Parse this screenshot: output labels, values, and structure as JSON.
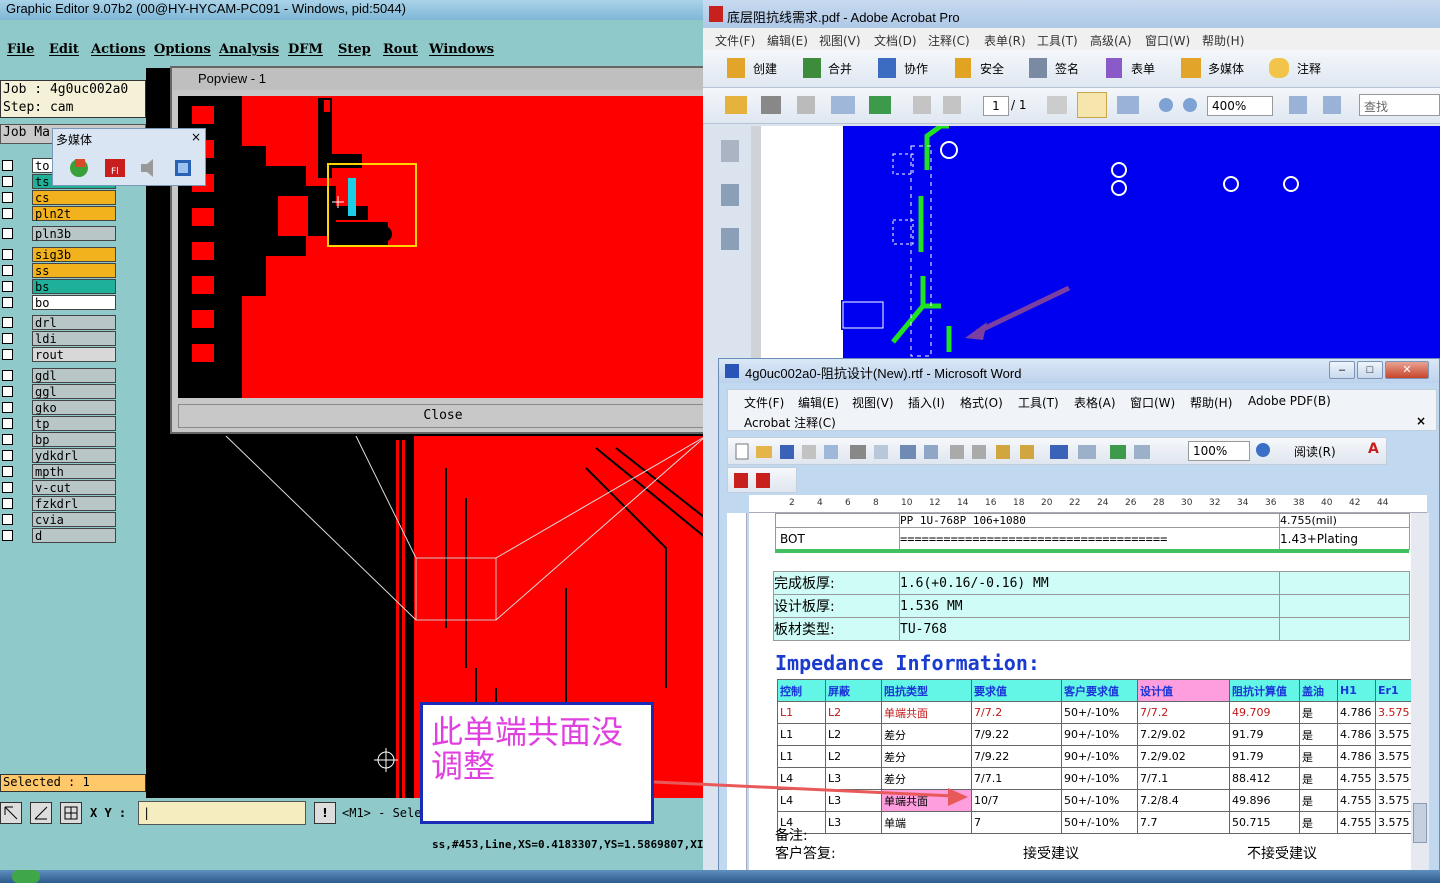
{
  "ge": {
    "title": "Graphic Editor 9.07b2 (00@HY-HYCAM-PC091 - Windows, pid:5044)",
    "menus": [
      "File",
      "Edit",
      "Actions",
      "Options",
      "Analysis",
      "DFM",
      "Step",
      "Rout",
      "Windows"
    ],
    "job_line": "Job : 4g0uc002a0",
    "step_line": "Step: cam",
    "job_tab": "Job Ma",
    "layers": [
      {
        "name": "to",
        "color": "#ffffff"
      },
      {
        "name": "ts",
        "color": "#1fb09a"
      },
      {
        "name": "cs",
        "color": "#f2b21e"
      },
      {
        "name": "pln2t",
        "color": "#f2b21e"
      },
      {
        "name": "pln3b",
        "color": "#b9c6c8"
      },
      {
        "name": "sig3b",
        "color": "#f2b21e"
      },
      {
        "name": "ss",
        "color": "#f2b21e"
      },
      {
        "name": "bs",
        "color": "#1fb09a"
      },
      {
        "name": "bo",
        "color": "#ffffff"
      },
      {
        "name": "drl",
        "color": "#b9c6c8"
      },
      {
        "name": "ldi",
        "color": "#b9c6c8"
      },
      {
        "name": "rout",
        "color": "#d8d8d8"
      },
      {
        "name": "gdl",
        "color": "#b9c6c8"
      },
      {
        "name": "ggl",
        "color": "#b9c6c8"
      },
      {
        "name": "gko",
        "color": "#b9c6c8"
      },
      {
        "name": "tp",
        "color": "#b9c6c8"
      },
      {
        "name": "bp",
        "color": "#b9c6c8"
      },
      {
        "name": "ydkdrl",
        "color": "#b9c6c8"
      },
      {
        "name": "mpth",
        "color": "#b9c6c8"
      },
      {
        "name": "v-cut",
        "color": "#b9c6c8"
      },
      {
        "name": "fzkdrl",
        "color": "#b9c6c8"
      },
      {
        "name": "cvia",
        "color": "#b9c6c8"
      },
      {
        "name": "d",
        "color": "#b9c6c8"
      }
    ],
    "selected": "Selected : 1",
    "xy_label": "X Y :",
    "xy_value": "|",
    "mode_text": "<M1> - Sele",
    "status_text": "ss,#453,Line,XS=0.4183307,YS=1.5869807,XI"
  },
  "popview": {
    "title": "Popview - 1",
    "close_label": "Close"
  },
  "multimedia": {
    "title": "多媒体",
    "close": "×"
  },
  "callout": {
    "text_line1": "此单端共面没",
    "text_line2": "调整"
  },
  "acrobat": {
    "title": "底层阻抗线需求.pdf - Adobe Acrobat Pro",
    "menus": [
      "文件(F)",
      "编辑(E)",
      "视图(V)",
      "文档(D)",
      "注释(C)",
      "表单(R)",
      "工具(T)",
      "高级(A)",
      "窗口(W)",
      "帮助(H)"
    ],
    "toolbar1": [
      "创建",
      "合并",
      "协作",
      "安全",
      "签名",
      "表单",
      "多媒体",
      "注释"
    ],
    "page_current": "1",
    "page_count": "/ 1",
    "zoom": "400%",
    "search_placeholder": "查找"
  },
  "word": {
    "title": "4g0uc002a0-阻抗设计(New).rtf - Microsoft Word",
    "menus": [
      "文件(F)",
      "编辑(E)",
      "视图(V)",
      "插入(I)",
      "格式(O)",
      "工具(T)",
      "表格(A)",
      "窗口(W)",
      "帮助(H)",
      "Adobe PDF(B)"
    ],
    "acrobat_comment": "Acrobat 注释(C)",
    "zoom": "100%",
    "read_label": "阅读(R)",
    "ruler_ticks": [
      "2",
      "4",
      "6",
      "8",
      "10",
      "12",
      "14",
      "16",
      "18",
      "20",
      "22",
      "24",
      "26",
      "28",
      "30",
      "32",
      "34",
      "36",
      "38",
      "40",
      "42",
      "44"
    ],
    "top_rows": [
      {
        "c1": "",
        "c2": "PP      1U-768P     106+1080",
        "c3": "4.755(mil)"
      },
      {
        "c1": "BOT",
        "c2": "=====================================",
        "c3": "1.43+Plating"
      }
    ],
    "info_rows": [
      {
        "label": "完成板厚:",
        "value": "1.6(+0.16/-0.16) MM"
      },
      {
        "label": "设计板厚:",
        "value": "1.536 MM"
      },
      {
        "label": "板材类型:",
        "value": "TU-768"
      }
    ],
    "impedance_title": "Impedance Information:",
    "impedance_headers": [
      "控制",
      "屏蔽",
      "阻抗类型",
      "要求值",
      "客户要求值",
      "设计值",
      "阻抗计算值",
      "盖油",
      "H1",
      "Er1"
    ],
    "impedance_rows": [
      [
        "L1",
        "L2",
        "单端共面",
        "7/7.2",
        "50+/-10%",
        "7/7.2",
        "49.709",
        "是",
        "4.786",
        "3.575"
      ],
      [
        "L1",
        "L2",
        "差分",
        "7/9.22",
        "90+/-10%",
        "7.2/9.02",
        "91.79",
        "是",
        "4.786",
        "3.575"
      ],
      [
        "L1",
        "L2",
        "差分",
        "7/9.22",
        "90+/-10%",
        "7.2/9.02",
        "91.79",
        "是",
        "4.786",
        "3.575"
      ],
      [
        "L4",
        "L3",
        "差分",
        "7/7.1",
        "90+/-10%",
        "7/7.1",
        "88.412",
        "是",
        "4.755",
        "3.575"
      ],
      [
        "L4",
        "L3",
        "单端共面",
        "10/7",
        "50+/-10%",
        "7.2/8.4",
        "49.896",
        "是",
        "4.755",
        "3.575"
      ],
      [
        "L4",
        "L3",
        "单端",
        "7",
        "50+/-10%",
        "7.7",
        "50.715",
        "是",
        "4.755",
        "3.575"
      ]
    ],
    "remark_label": "备注:",
    "reply_label": "客户答复:",
    "accept_label": "接受建议",
    "reject_label": "不接受建议"
  }
}
